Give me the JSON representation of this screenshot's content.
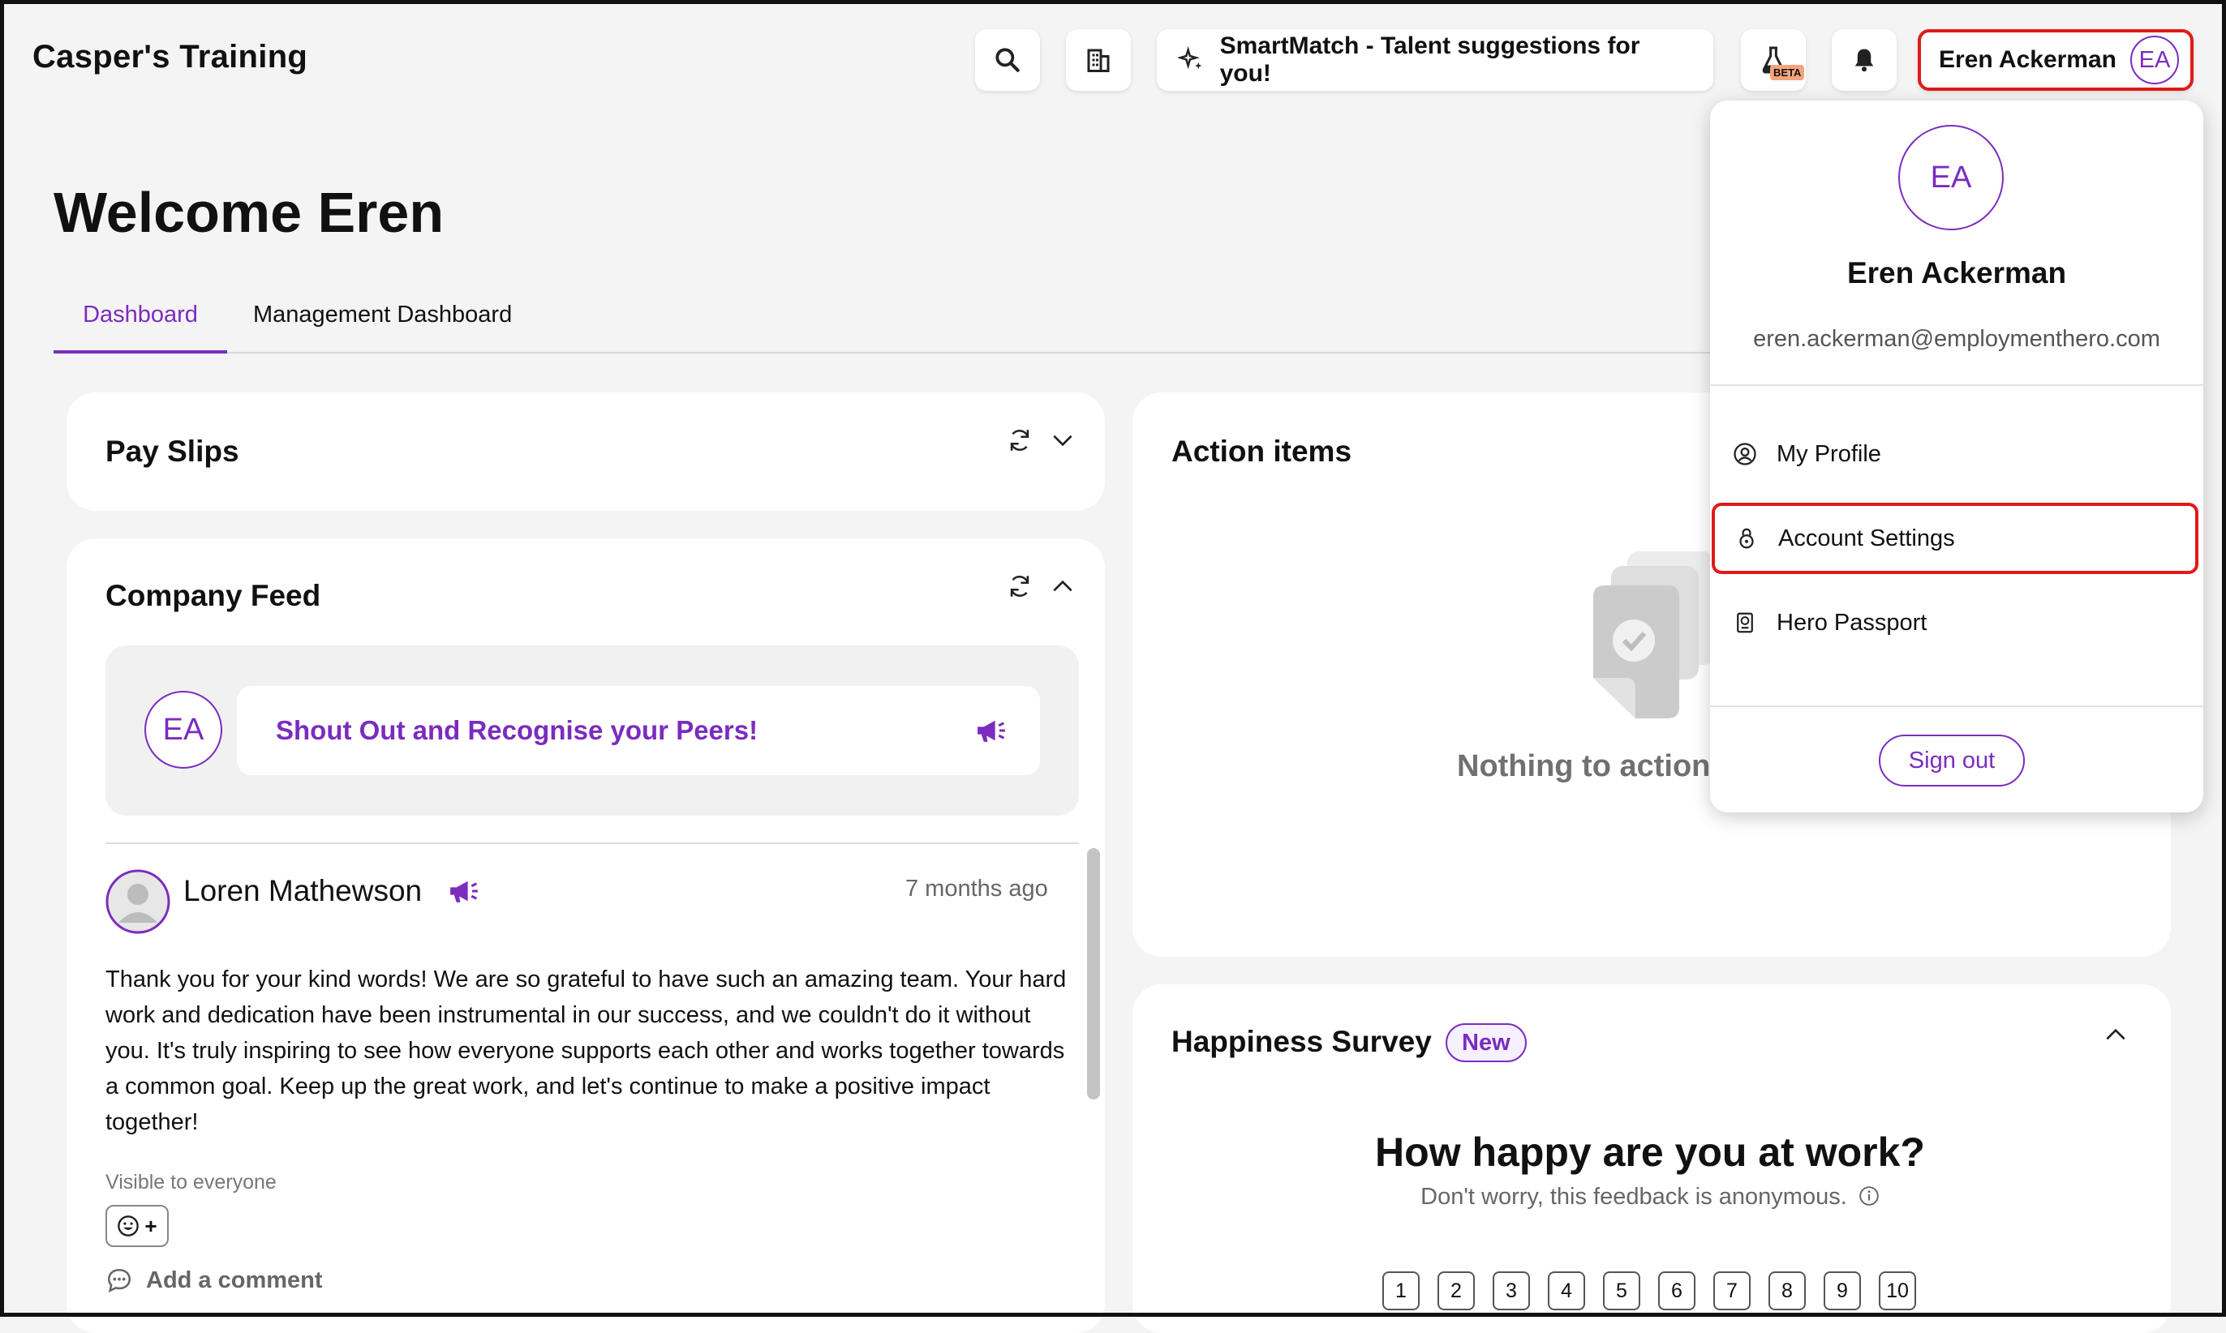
{
  "app": {
    "title": "Casper's Training"
  },
  "topbar": {
    "smartmatch_label": "SmartMatch - Talent suggestions for you!",
    "beta_label": "BETA",
    "user_name": "Eren Ackerman",
    "user_initials": "EA"
  },
  "page": {
    "welcome": "Welcome Eren"
  },
  "tabs": [
    {
      "label": "Dashboard",
      "active": true
    },
    {
      "label": "Management Dashboard",
      "active": false
    }
  ],
  "payslips": {
    "title": "Pay Slips"
  },
  "feed": {
    "title": "Company Feed",
    "shout_initials": "EA",
    "shout_label": "Shout Out and Recognise your Peers!",
    "post": {
      "author": "Loren Mathewson",
      "time": "7 months ago",
      "body": "Thank you for your kind words! We are so grateful to have such an amazing team. Your hard work and dedication have been instrumental in our success, and we couldn't do it without you. It's truly inspiring to see how everyone supports each other and works together towards a common goal. Keep up the great work, and let's continue to make a positive impact together!",
      "visibility": "Visible to everyone",
      "reaction_plus": "+",
      "comment_label": "Add a comment"
    }
  },
  "actions": {
    "title": "Action items",
    "empty_text": "Nothing to action"
  },
  "survey": {
    "title": "Happiness Survey",
    "badge": "New",
    "question": "How happy are you at work?",
    "subtext": "Don't worry, this feedback is anonymous.",
    "scale": [
      "1",
      "2",
      "3",
      "4",
      "5",
      "6",
      "7",
      "8",
      "9",
      "10"
    ]
  },
  "user_menu": {
    "initials": "EA",
    "name": "Eren Ackerman",
    "email": "eren.ackerman@employmenthero.com",
    "items": [
      {
        "label": "My Profile",
        "icon": "user-circle-icon"
      },
      {
        "label": "Account Settings",
        "icon": "lock-icon"
      },
      {
        "label": "Hero Passport",
        "icon": "passport-icon"
      }
    ],
    "sign_out": "Sign out"
  },
  "colors": {
    "accent": "#7b2cbf",
    "highlight": "#e01a1a",
    "background": "#f4f4f4"
  }
}
